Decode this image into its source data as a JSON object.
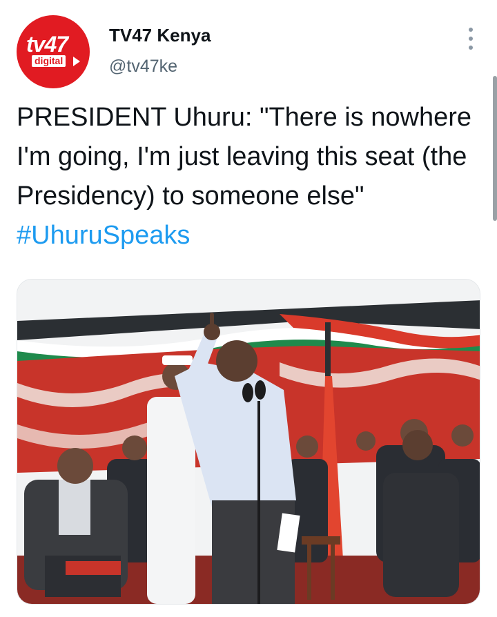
{
  "tweet": {
    "author": {
      "display_name": "TV47 Kenya",
      "handle": "@tv47ke",
      "avatar_logo_text": "tv47",
      "avatar_logo_subtext": "digital"
    },
    "text_parts": {
      "body": "PRESIDENT Uhuru: \"There is nowhere I'm going, I'm just leaving this seat (the Presidency) to someone else\" ",
      "hashtag": "#UhuruSpeaks"
    },
    "media": {
      "type": "photo",
      "icons": [
        "more-options-icon"
      ]
    },
    "colors": {
      "link": "#1d9bf0",
      "secondary_text": "#536471",
      "brand_red": "#e11b22"
    }
  }
}
